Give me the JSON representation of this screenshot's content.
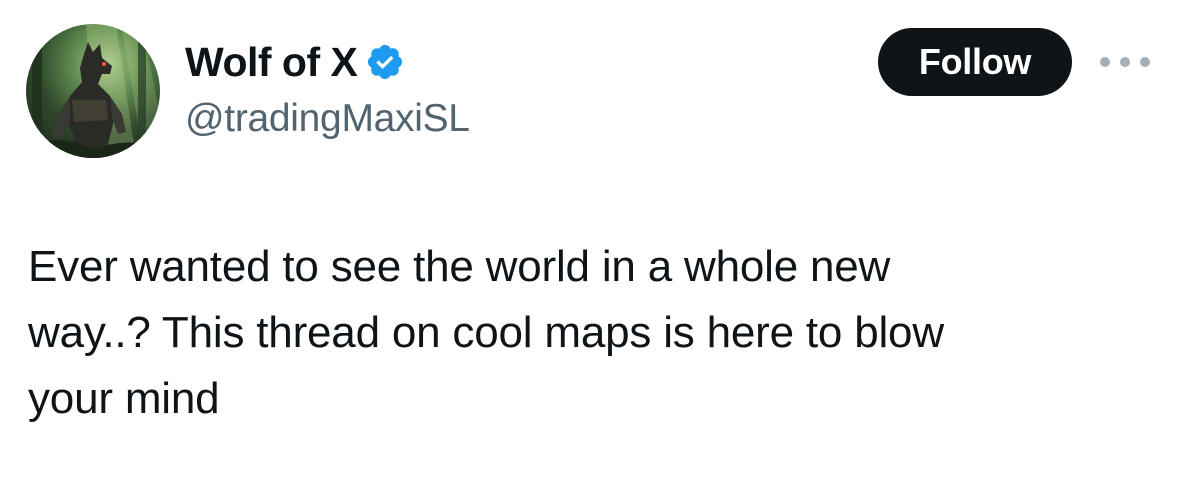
{
  "author": {
    "display_name": "Wolf of X",
    "handle": "@tradingMaxiSL",
    "verified": true,
    "avatar_icon": "wolf-warrior-avatar"
  },
  "actions": {
    "follow_label": "Follow",
    "more_icon": "more-horizontal-icon"
  },
  "tweet": {
    "text": "Ever wanted to see the world in a whole new\nway..? This thread on cool maps is here to blow\nyour mind"
  },
  "colors": {
    "text_primary": "#0f1419",
    "text_secondary": "#536471",
    "verified_blue": "#1d9bf0",
    "follow_bg": "#0f1419",
    "follow_text": "#ffffff"
  }
}
